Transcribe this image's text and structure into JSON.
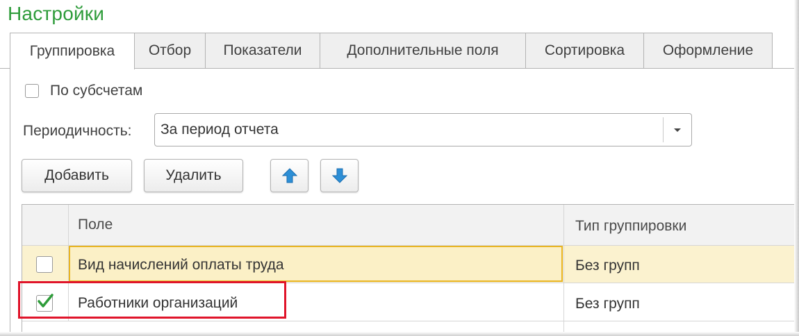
{
  "title": "Настройки",
  "tabs": [
    {
      "label": "Группировка",
      "active": true
    },
    {
      "label": "Отбор",
      "active": false
    },
    {
      "label": "Показатели",
      "active": false
    },
    {
      "label": "Дополнительные поля",
      "active": false
    },
    {
      "label": "Сортировка",
      "active": false
    },
    {
      "label": "Оформление",
      "active": false
    }
  ],
  "subaccounts": {
    "label": "По субсчетам",
    "checked": false
  },
  "periodicity": {
    "label": "Периодичность:",
    "value": "За период отчета"
  },
  "toolbar": {
    "add_label": "Добавить",
    "delete_label": "Удалить",
    "up_icon": "arrow-up-icon",
    "down_icon": "arrow-down-icon"
  },
  "table": {
    "columns": [
      "Поле",
      "Тип группировки"
    ],
    "rows": [
      {
        "checked": false,
        "field": "Вид начислений оплаты труда",
        "type": "Без групп",
        "selected": true
      },
      {
        "checked": true,
        "field": "Работники организаций",
        "type": "Без групп",
        "highlighted": true
      }
    ]
  },
  "colors": {
    "title": "#2e9c3a",
    "accent_blue": "#2d8fd6",
    "selected_row": "#fbf2cf",
    "highlight_border": "#e0142a",
    "check": "#2e9c3a"
  }
}
